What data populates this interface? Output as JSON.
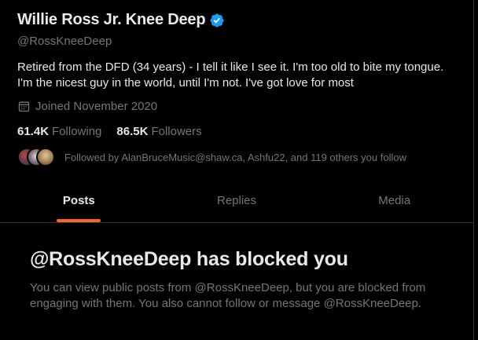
{
  "profile": {
    "display_name": "Willie Ross Jr. Knee Deep",
    "handle": "@RossKneeDeep",
    "verified_icon": "verified-badge-icon",
    "bio_lines": [
      "Retired from the DFD (34 years) - I tell it like I see it. I'm too old to bite my tongue.",
      "I'm the nicest guy in the world, until I'm not. I've got love for most"
    ],
    "joined": "Joined November 2020",
    "following_count": "61.4K",
    "following_label": "Following",
    "followers_count": "86.5K",
    "followers_label": "Followers",
    "followed_by": "Followed by AlanBruceMusic@shaw.ca, Ashfu22, and 119 others you follow"
  },
  "tabs": [
    {
      "label": "Posts",
      "active": true
    },
    {
      "label": "Replies",
      "active": false
    },
    {
      "label": "Media",
      "active": false
    }
  ],
  "blocked_notice": {
    "title": "@RossKneeDeep has blocked you",
    "body_lines": [
      "You can view public posts from @RossKneeDeep, but you are blocked from",
      "engaging with them. You also cannot follow or message @RossKneeDeep."
    ]
  },
  "colors": {
    "background": "#000000",
    "text_primary": "#e7e9ea",
    "text_secondary": "#71767b",
    "verified_blue": "#1d9bf0",
    "tab_underline": "#f3662d",
    "divider": "#2f3336"
  }
}
